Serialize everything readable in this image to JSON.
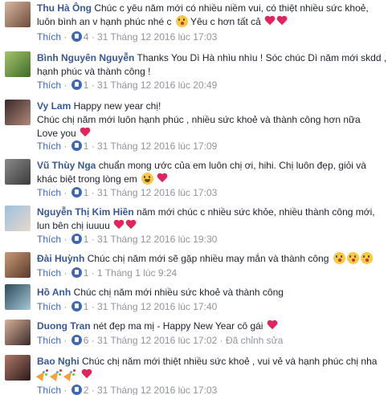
{
  "like_label": "Thích",
  "edited_label": "Đã chỉnh sửa",
  "comments": [
    {
      "author": "Thu Hà Ông",
      "text": "Chúc c yêu năm mới có nhiều niềm vui, có thiệt nhiều sức khoẻ, luôn bình an v hạnh phúc nhé c",
      "text2": "Yêu c hơn tất cả",
      "likes": "4",
      "time": "31 Tháng 12 2016 lúc 17:03"
    },
    {
      "author": "Bình Nguyên Nguyễn",
      "text": "Thanks You Dì Hà nhìu nhìu ! Sóc chúc Dì năm mới skdd , hạnh phúc và thành công !",
      "likes": "1",
      "time": "31 Tháng 12 2016 lúc 20:49"
    },
    {
      "author": "Vy Lam",
      "text": "Happy new year chị!",
      "text2": "Chúc chị năm mới luôn hạnh phúc , nhiều sức khoẻ và thành công hơn nữa",
      "text3": "Love you",
      "likes": "1",
      "time": "31 Tháng 12 2016 lúc 17:09"
    },
    {
      "author": "Vũ Thùy Nga",
      "text": "chuẩn mong ước của em luôn chị ơi, hihi. Chị luôn đẹp, giỏi và khác biệt trong lòng em",
      "likes": "1",
      "time": "31 Tháng 12 2016 lúc 17:03"
    },
    {
      "author": "Nguyễn Thị Kim Hiền",
      "text": "năm mới chúc c nhiều sức khỏe, nhiều thành công mới, lun bên chị iuuuu",
      "likes": "1",
      "time": "31 Tháng 12 2016 lúc 19:30"
    },
    {
      "author": "Đài Huỳnh",
      "text": "Chúc chị năm mới sẽ gặp nhiều may mắn và thành công",
      "likes": "1",
      "time": "1 Tháng 1 lúc 9:24"
    },
    {
      "author": "Hồ Anh",
      "text": "Chúc chị năm mới nhiều sức khoẻ và thành công",
      "likes": "1",
      "time": "31 Tháng 12 2016 lúc 17:40"
    },
    {
      "author": "Duong Tran",
      "text": "nét đẹp ma mị - Happy New Year cô gái",
      "likes": "6",
      "time": "31 Tháng 12 2016 lúc 17:02"
    },
    {
      "author": "Bao Nghi",
      "text": "Chúc chị năm mới thiệt nhiều sức khoẻ , vui vẻ và hạnh phúc chị nha",
      "likes": "2",
      "time": "31 Tháng 12 2016 lúc 17:03"
    }
  ]
}
